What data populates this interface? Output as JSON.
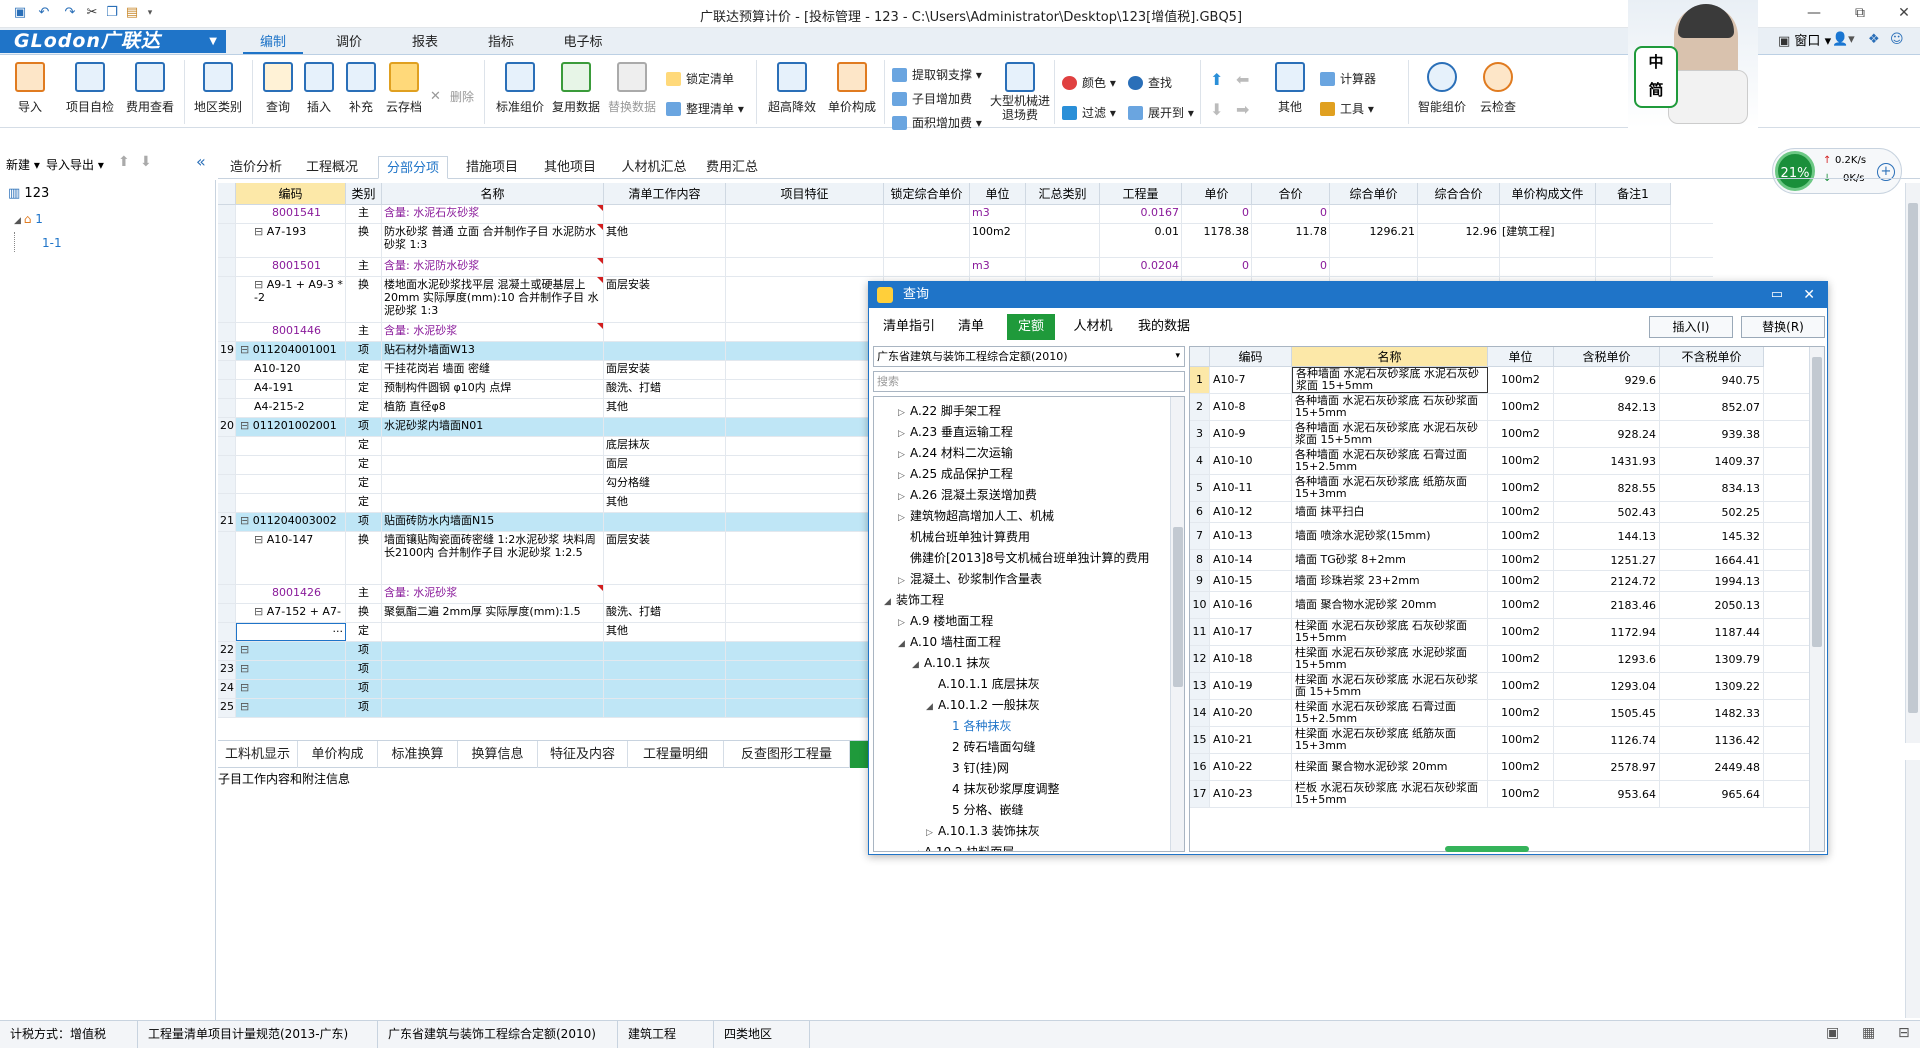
{
  "title": "广联达预算计价 - [投标管理 - 123 - C:\\Users\\Administrator\\Desktop\\123[增值税].GBQ5]",
  "menu": {
    "logo": "GLodon广联达",
    "tabs": [
      "编制",
      "调价",
      "报表",
      "指标",
      "电子标"
    ]
  },
  "ribbon": {
    "big": [
      "导入",
      "项目自检",
      "费用查看",
      "地区类别",
      "查询",
      "插入",
      "补充",
      "云存档",
      "标准组价",
      "复用数据",
      "替换数据",
      "超高降效",
      "单价构成",
      "大型机械进退场费",
      "其他",
      "智能组价",
      "云检查"
    ],
    "delete": "删除",
    "lock_list": "锁定清单",
    "tidy_list": "整理清单",
    "steel": "提取钢支撑",
    "sub_increase": "子目增加费",
    "area_increase": "面积增加费",
    "color": "颜色",
    "find": "查找",
    "filter": "过滤",
    "expand": "展开到",
    "calc": "计算器",
    "tools": "工具",
    "window": "窗口"
  },
  "avatar": {
    "badge1": "中",
    "badge2": "简"
  },
  "speed": {
    "percent": "21%",
    "up": "0.2K/s",
    "down": "0K/s"
  },
  "left": {
    "new": "新建",
    "import_export": "导入导出",
    "tree": [
      "123",
      "1",
      "1-1"
    ]
  },
  "content_tabs": [
    "造价分析",
    "工程概况",
    "分部分项",
    "措施项目",
    "其他项目",
    "人材机汇总",
    "费用汇总"
  ],
  "grid": {
    "headers": [
      "",
      "编码",
      "类别",
      "名称",
      "清单工作内容",
      "项目特征",
      "锁定综合单价",
      "单位",
      "汇总类别",
      "工程量",
      "单价",
      "合价",
      "综合单价",
      "综合合价",
      "单价构成文件",
      "备注1"
    ],
    "rows": [
      {
        "seq": "",
        "code": "8001541",
        "type": "主",
        "name": "含量: 水泥石灰砂浆",
        "work": "",
        "unit": "m3",
        "qty": "0.0167",
        "price": "0",
        "total": "0",
        "uprice": "",
        "utotal": "",
        "file": "",
        "purple": true
      },
      {
        "seq": "",
        "code": "A7-193",
        "type": "换",
        "name": "防水砂浆 普通 立面  合并制作子目 水泥防水砂浆 1:3",
        "work": "其他",
        "unit": "100m2",
        "qty": "0.01",
        "price": "1178.38",
        "total": "11.78",
        "uprice": "1296.21",
        "utotal": "12.96",
        "file": "[建筑工程]"
      },
      {
        "seq": "",
        "code": "8001501",
        "type": "主",
        "name": "含量: 水泥防水砂浆",
        "work": "",
        "unit": "m3",
        "qty": "0.0204",
        "price": "0",
        "total": "0",
        "uprice": "",
        "utotal": "",
        "file": "",
        "purple": true
      },
      {
        "seq": "",
        "code": "A9-1 + A9-3 * -2",
        "type": "换",
        "name": "楼地面水泥砂浆找平层 混凝土或硬基层上 20mm  实际厚度(mm):10  合并制作子目 水泥砂浆 1:3",
        "work": "面层安装",
        "unit": "",
        "qty": "",
        "price": "",
        "total": "",
        "uprice": "",
        "utotal": "",
        "file": ""
      },
      {
        "seq": "",
        "code": "8001446",
        "type": "主",
        "name": "含量: 水泥砂浆",
        "work": "",
        "unit": "",
        "qty": "",
        "price": "",
        "total": "",
        "uprice": "",
        "utotal": "",
        "file": "",
        "purple": true
      },
      {
        "seq": "19",
        "code": "011204001001",
        "type": "项",
        "name": "贴石材外墙面W13",
        "work": "",
        "unit": "",
        "qty": "",
        "price": "",
        "total": "",
        "uprice": "",
        "utotal": "",
        "file": "",
        "blue": true
      },
      {
        "seq": "",
        "code": "A10-120",
        "type": "定",
        "name": "干挂花岗岩 墙面 密缝",
        "work": "面层安装",
        "unit": "",
        "qty": "",
        "price": "",
        "total": "",
        "uprice": "",
        "utotal": "",
        "file": ""
      },
      {
        "seq": "",
        "code": "A4-191",
        "type": "定",
        "name": "预制构件圆钢 φ10内 点焊",
        "work": "酸洗、打蜡",
        "unit": "",
        "qty": "",
        "price": "",
        "total": "",
        "uprice": "",
        "utotal": "",
        "file": ""
      },
      {
        "seq": "",
        "code": "A4-215-2",
        "type": "定",
        "name": "植筋 直径φ8",
        "work": "其他",
        "unit": "",
        "qty": "",
        "price": "",
        "total": "",
        "uprice": "",
        "utotal": "",
        "file": ""
      },
      {
        "seq": "20",
        "code": "011201002001",
        "type": "项",
        "name": "水泥砂浆内墙面N01",
        "work": "",
        "unit": "",
        "qty": "",
        "price": "",
        "total": "",
        "uprice": "",
        "utotal": "",
        "file": "",
        "blue": true
      },
      {
        "seq": "",
        "code": "",
        "type": "定",
        "name": "",
        "work": "底层抹灰",
        "unit": "",
        "qty": "",
        "price": "",
        "total": "",
        "uprice": "",
        "utotal": "",
        "file": ""
      },
      {
        "seq": "",
        "code": "",
        "type": "定",
        "name": "",
        "work": "面层",
        "unit": "",
        "qty": "",
        "price": "",
        "total": "",
        "uprice": "",
        "utotal": "",
        "file": ""
      },
      {
        "seq": "",
        "code": "",
        "type": "定",
        "name": "",
        "work": "勾分格缝",
        "unit": "",
        "qty": "",
        "price": "",
        "total": "",
        "uprice": "",
        "utotal": "",
        "file": ""
      },
      {
        "seq": "",
        "code": "",
        "type": "定",
        "name": "",
        "work": "其他",
        "unit": "",
        "qty": "",
        "price": "",
        "total": "",
        "uprice": "",
        "utotal": "",
        "file": ""
      },
      {
        "seq": "21",
        "code": "011204003002",
        "type": "项",
        "name": "贴面砖防水内墙面N15",
        "work": "",
        "unit": "",
        "qty": "",
        "price": "",
        "total": "",
        "uprice": "",
        "utotal": "",
        "file": "",
        "blue": true
      },
      {
        "seq": "",
        "code": "A10-147",
        "type": "换",
        "name": "墙面镶贴陶瓷面砖密缝 1:2水泥砂浆 块料周长2100内  合并制作子目 水泥砂浆 1:2.5",
        "work": "面层安装",
        "unit": "",
        "qty": "",
        "price": "",
        "total": "",
        "uprice": "",
        "utotal": "",
        "file": ""
      },
      {
        "seq": "",
        "code": "8001426",
        "type": "主",
        "name": "含量: 水泥砂浆",
        "work": "",
        "unit": "",
        "qty": "",
        "price": "",
        "total": "",
        "uprice": "",
        "utotal": "",
        "file": "",
        "purple": true
      },
      {
        "seq": "",
        "code": "A7-152 + A7-···",
        "type": "换",
        "name": "聚氨酯二遍 2mm厚  实际厚度(mm):1.5",
        "work": "酸洗、打蜡",
        "unit": "",
        "qty": "",
        "price": "",
        "total": "",
        "uprice": "",
        "utotal": "",
        "file": ""
      },
      {
        "seq": "",
        "code": "···",
        "type": "定",
        "name": "",
        "work": "其他",
        "unit": "",
        "qty": "",
        "price": "",
        "total": "",
        "uprice": "",
        "utotal": "",
        "file": "",
        "editing": true
      },
      {
        "seq": "22",
        "code": "",
        "type": "项",
        "name": "",
        "work": "",
        "unit": "",
        "qty": "",
        "price": "",
        "total": "",
        "uprice": "",
        "utotal": "",
        "file": "",
        "blue": true
      },
      {
        "seq": "23",
        "code": "",
        "type": "项",
        "name": "",
        "work": "",
        "unit": "",
        "qty": "",
        "price": "",
        "total": "",
        "uprice": "",
        "utotal": "",
        "file": "",
        "blue": true
      },
      {
        "seq": "24",
        "code": "",
        "type": "项",
        "name": "",
        "work": "",
        "unit": "",
        "qty": "",
        "price": "",
        "total": "",
        "uprice": "",
        "utotal": "",
        "file": "",
        "blue": true
      },
      {
        "seq": "25",
        "code": "",
        "type": "项",
        "name": "",
        "work": "",
        "unit": "",
        "qty": "",
        "price": "",
        "total": "",
        "uprice": "",
        "utotal": "",
        "file": "",
        "blue": true
      }
    ]
  },
  "bottom_tabs": [
    "工料机显示",
    "单价构成",
    "标准换算",
    "换算信息",
    "特征及内容",
    "工程量明细",
    "反查图形工程量"
  ],
  "bottom_sub": "子目工作内容和附注信息",
  "dialog": {
    "title": "查询",
    "tabs": [
      "清单指引",
      "清单",
      "定额",
      "人材机",
      "我的数据"
    ],
    "insert": "插入(I)",
    "replace": "替换(R)",
    "quota_lib": "广东省建筑与装饰工程综合定额(2010)",
    "search_placeholder": "搜索",
    "tree": [
      {
        "t": "A.22 脚手架工程",
        "lv": 1,
        "ar": "▷"
      },
      {
        "t": "A.23 垂直运输工程",
        "lv": 1,
        "ar": "▷"
      },
      {
        "t": "A.24 材料二次运输",
        "lv": 1,
        "ar": "▷"
      },
      {
        "t": "A.25 成品保护工程",
        "lv": 1,
        "ar": "▷"
      },
      {
        "t": "A.26 混凝土泵送增加费",
        "lv": 1,
        "ar": "▷"
      },
      {
        "t": "建筑物超高增加人工、机械",
        "lv": 1,
        "ar": "▷"
      },
      {
        "t": "机械台班单独计算费用",
        "lv": 1,
        "ar": ""
      },
      {
        "t": "佛建价[2013]8号文机械台班单独计算的费用",
        "lv": 1,
        "ar": ""
      },
      {
        "t": "混凝土、砂浆制作含量表",
        "lv": 1,
        "ar": "▷"
      },
      {
        "t": "装饰工程",
        "lv": 0,
        "ar": "◢"
      },
      {
        "t": "A.9 楼地面工程",
        "lv": 1,
        "ar": "▷"
      },
      {
        "t": "A.10 墙柱面工程",
        "lv": 1,
        "ar": "◢"
      },
      {
        "t": "A.10.1 抹灰",
        "lv": 2,
        "ar": "◢"
      },
      {
        "t": "A.10.1.1 底层抹灰",
        "lv": 3,
        "ar": ""
      },
      {
        "t": "A.10.1.2 一般抹灰",
        "lv": 3,
        "ar": "◢"
      },
      {
        "t": "1 各种抹灰",
        "lv": 4,
        "ar": "",
        "sel": true
      },
      {
        "t": "2 砖石墙面勾缝",
        "lv": 4,
        "ar": ""
      },
      {
        "t": "3 钉(挂)网",
        "lv": 4,
        "ar": ""
      },
      {
        "t": "4 抹灰砂浆厚度调整",
        "lv": 4,
        "ar": ""
      },
      {
        "t": "5 分格、嵌缝",
        "lv": 4,
        "ar": ""
      },
      {
        "t": "A.10.1.3 装饰抹灰",
        "lv": 3,
        "ar": "▷"
      },
      {
        "t": "A.10.2 块料面层",
        "lv": 2,
        "ar": "◢"
      }
    ],
    "headers": [
      "",
      "编码",
      "名称",
      "单位",
      "含税单价",
      "不含税单价"
    ],
    "rows": [
      {
        "n": "1",
        "code": "A10-7",
        "name": "各种墙面 水泥石灰砂浆底 水泥石灰砂浆面 15+5mm",
        "unit": "100m2",
        "p1": "929.6",
        "p2": "940.75"
      },
      {
        "n": "2",
        "code": "A10-8",
        "name": "各种墙面 水泥石灰砂浆底 石灰砂浆面 15+5mm",
        "unit": "100m2",
        "p1": "842.13",
        "p2": "852.07"
      },
      {
        "n": "3",
        "code": "A10-9",
        "name": "各种墙面 水泥石灰砂浆底 水泥石灰砂浆面 15+5mm",
        "unit": "100m2",
        "p1": "928.24",
        "p2": "939.38"
      },
      {
        "n": "4",
        "code": "A10-10",
        "name": "各种墙面 水泥石灰砂浆底 石膏过面 15+2.5mm",
        "unit": "100m2",
        "p1": "1431.93",
        "p2": "1409.37"
      },
      {
        "n": "5",
        "code": "A10-11",
        "name": "各种墙面 水泥石灰砂浆底 纸筋灰面 15+3mm",
        "unit": "100m2",
        "p1": "828.55",
        "p2": "834.13"
      },
      {
        "n": "6",
        "code": "A10-12",
        "name": "墙面 抹平扫白",
        "unit": "100m2",
        "p1": "502.43",
        "p2": "502.25"
      },
      {
        "n": "7",
        "code": "A10-13",
        "name": "墙面 喷涂水泥砂浆(15mm)",
        "unit": "100m2",
        "p1": "144.13",
        "p2": "145.32"
      },
      {
        "n": "8",
        "code": "A10-14",
        "name": "墙面 TG砂浆 8+2mm",
        "unit": "100m2",
        "p1": "1251.27",
        "p2": "1664.41"
      },
      {
        "n": "9",
        "code": "A10-15",
        "name": "墙面 珍珠岩浆 23+2mm",
        "unit": "100m2",
        "p1": "2124.72",
        "p2": "1994.13"
      },
      {
        "n": "10",
        "code": "A10-16",
        "name": "墙面 聚合物水泥砂浆 20mm",
        "unit": "100m2",
        "p1": "2183.46",
        "p2": "2050.13"
      },
      {
        "n": "11",
        "code": "A10-17",
        "name": "柱梁面 水泥石灰砂浆底 石灰砂浆面 15+5mm",
        "unit": "100m2",
        "p1": "1172.94",
        "p2": "1187.44"
      },
      {
        "n": "12",
        "code": "A10-18",
        "name": "柱梁面 水泥石灰砂浆底 水泥砂浆面 15+5mm",
        "unit": "100m2",
        "p1": "1293.6",
        "p2": "1309.79"
      },
      {
        "n": "13",
        "code": "A10-19",
        "name": "柱梁面 水泥石灰砂浆底 水泥石灰砂浆面 15+5mm",
        "unit": "100m2",
        "p1": "1293.04",
        "p2": "1309.22"
      },
      {
        "n": "14",
        "code": "A10-20",
        "name": "柱梁面 水泥石灰砂浆底 石膏过面 15+2.5mm",
        "unit": "100m2",
        "p1": "1505.45",
        "p2": "1482.33"
      },
      {
        "n": "15",
        "code": "A10-21",
        "name": "柱梁面 水泥石灰砂浆底 纸筋灰面 15+3mm",
        "unit": "100m2",
        "p1": "1126.74",
        "p2": "1136.42"
      },
      {
        "n": "16",
        "code": "A10-22",
        "name": "柱梁面 聚合物水泥砂浆 20mm",
        "unit": "100m2",
        "p1": "2578.97",
        "p2": "2449.48"
      },
      {
        "n": "17",
        "code": "A10-23",
        "name": "栏板 水泥石灰砂浆底 水泥石灰砂浆面 15+5mm",
        "unit": "100m2",
        "p1": "953.64",
        "p2": "965.64"
      }
    ]
  },
  "status": [
    "计税方式：增值税",
    "工程量清单项目计量规范(2013-广东)",
    "广东省建筑与装饰工程综合定额(2010)",
    "建筑工程",
    "四类地区"
  ],
  "colors": {
    "accent": "#1f74c8",
    "green": "#1f9a3b",
    "purple": "#8a1b9b",
    "row_blue": "#bfe6f6",
    "header_hl": "#fce8a8"
  }
}
